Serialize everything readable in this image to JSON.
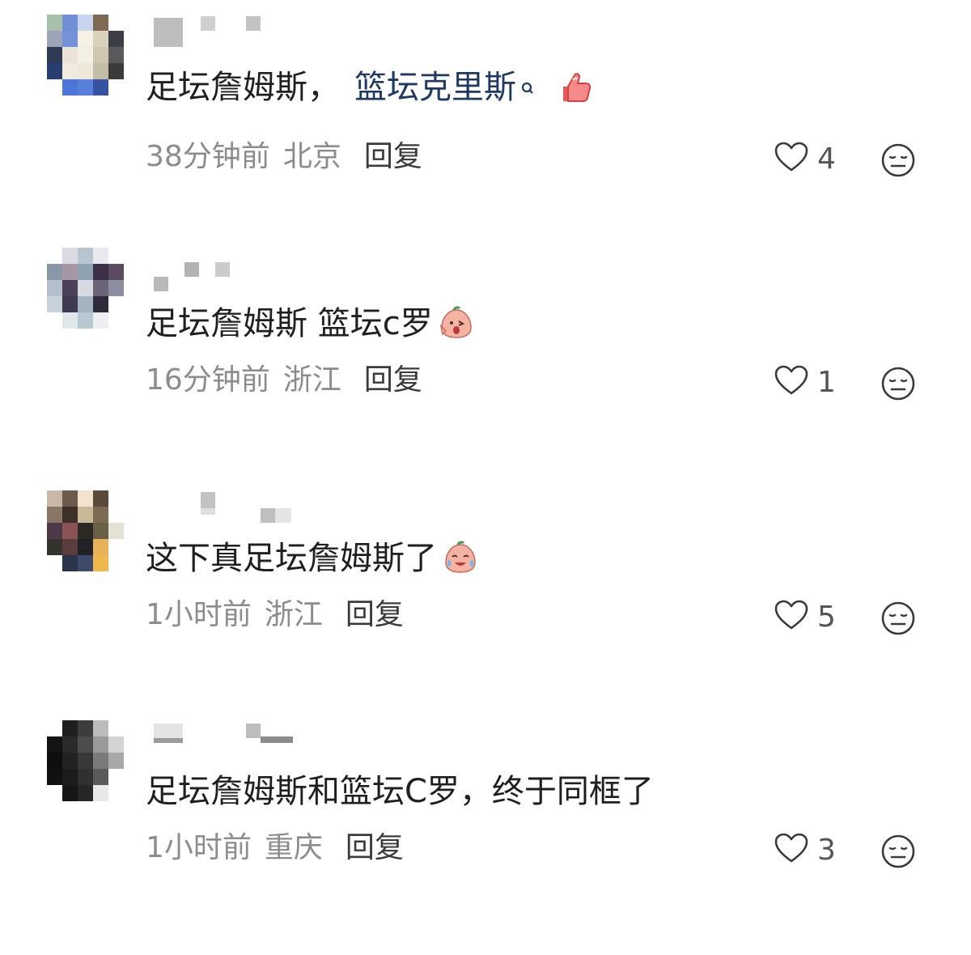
{
  "comments": [
    {
      "text_before_link": "足坛詹姆斯，",
      "link_text": "篮坛克里斯",
      "text_after": "",
      "time": "38分钟前",
      "location": "北京",
      "reply_label": "回复",
      "likes": "4",
      "emoji": "thumbs-up-emoji"
    },
    {
      "text_before_link": "足坛詹姆斯 篮坛c罗",
      "link_text": "",
      "text_after": "",
      "time": "16分钟前",
      "location": "浙江",
      "reply_label": "回复",
      "likes": "1",
      "emoji": "peach-wink-emoji"
    },
    {
      "text_before_link": "这下真足坛詹姆斯了",
      "link_text": "",
      "text_after": "",
      "time": "1小时前",
      "location": "浙江",
      "reply_label": "回复",
      "likes": "5",
      "emoji": "peach-laugh-cry-emoji"
    },
    {
      "text_before_link": "足坛詹姆斯和篮坛C罗，终于同框了",
      "link_text": "",
      "text_after": "",
      "time": "1小时前",
      "location": "重庆",
      "reply_label": "回复",
      "likes": "3",
      "emoji": ""
    }
  ],
  "colors": {
    "link": "#1f3a62",
    "meta": "#8c8c8c",
    "icon": "#3a3a3a"
  }
}
